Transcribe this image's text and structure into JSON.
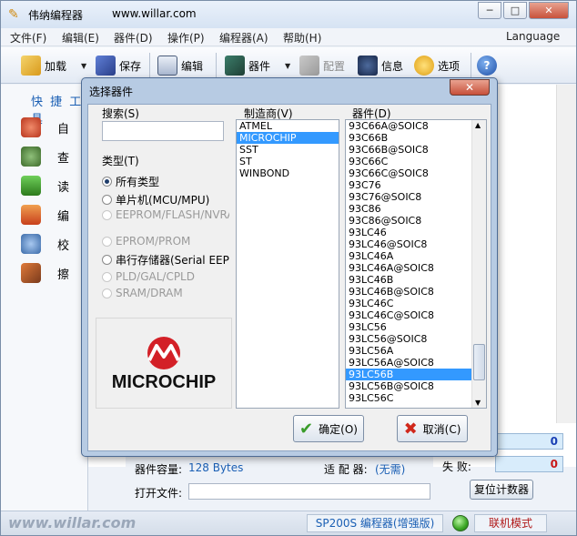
{
  "window": {
    "title": "伟纳编程器",
    "url": "www.willar.com",
    "min": "─",
    "max": "□",
    "close": "✕"
  },
  "menu": [
    "文件(F)",
    "编辑(E)",
    "器件(D)",
    "操作(P)",
    "编程器(A)",
    "帮助(H)"
  ],
  "menu_language": "Language",
  "toolbar": {
    "load": "加载",
    "save": "保存",
    "edit": "编辑",
    "device": "器件",
    "config": "配置",
    "info": "信息",
    "options": "选项"
  },
  "sidebar": {
    "title": "快 捷 工 具",
    "items": [
      "自",
      "查",
      "读",
      "编",
      "校",
      "擦"
    ]
  },
  "bottom": {
    "capacity_label": "器件容量:",
    "capacity_value": "128 Bytes",
    "adapter_label": "适 配 器:",
    "adapter_value": "(无需)",
    "fail_label": "失 败:",
    "success_value": "0",
    "fail_value": "0",
    "openfile_label": "打开文件:",
    "reset_button": "复位计数器"
  },
  "statusbar": {
    "logo": "www.willar.com",
    "programmer": "SP200S 编程器(增强版)",
    "mode": "联机模式"
  },
  "dialog": {
    "title": "选择器件",
    "search_label": "搜索(S)",
    "type_label": "类型(T)",
    "types": [
      {
        "label": "所有类型",
        "checked": true,
        "enabled": true
      },
      {
        "label": "单片机(MCU/MPU)",
        "checked": false,
        "enabled": true
      },
      {
        "label": "EEPROM/FLASH/NVRA M",
        "checked": false,
        "enabled": false
      },
      {
        "label": "EPROM/PROM",
        "checked": false,
        "enabled": false
      },
      {
        "label": "串行存储器(Serial EEPR",
        "checked": false,
        "enabled": true
      },
      {
        "label": "PLD/GAL/CPLD",
        "checked": false,
        "enabled": false
      },
      {
        "label": "SRAM/DRAM",
        "checked": false,
        "enabled": false
      }
    ],
    "logo_text": "MICROCHIP",
    "manufacturer_label": "制造商(V)",
    "manufacturers": [
      "ATMEL",
      "MICROCHIP",
      "SST",
      "ST",
      "WINBOND"
    ],
    "selected_manufacturer": 1,
    "device_label": "器件(D)",
    "devices": [
      "93C66A@SOIC8",
      "93C66B",
      "93C66B@SOIC8",
      "93C66C",
      "93C66C@SOIC8",
      "93C76",
      "93C76@SOIC8",
      "93C86",
      "93C86@SOIC8",
      "93LC46",
      "93LC46@SOIC8",
      "93LC46A",
      "93LC46A@SOIC8",
      "93LC46B",
      "93LC46B@SOIC8",
      "93LC46C",
      "93LC46C@SOIC8",
      "93LC56",
      "93LC56@SOIC8",
      "93LC56A",
      "93LC56A@SOIC8",
      "93LC56B",
      "93LC56B@SOIC8",
      "93LC56C"
    ],
    "selected_device": 21,
    "ok": "确定(O)",
    "cancel": "取消(C)"
  },
  "colors": {
    "accent": "#1a5fb4",
    "selection": "#3399ff",
    "microchip_red": "#d32027"
  }
}
